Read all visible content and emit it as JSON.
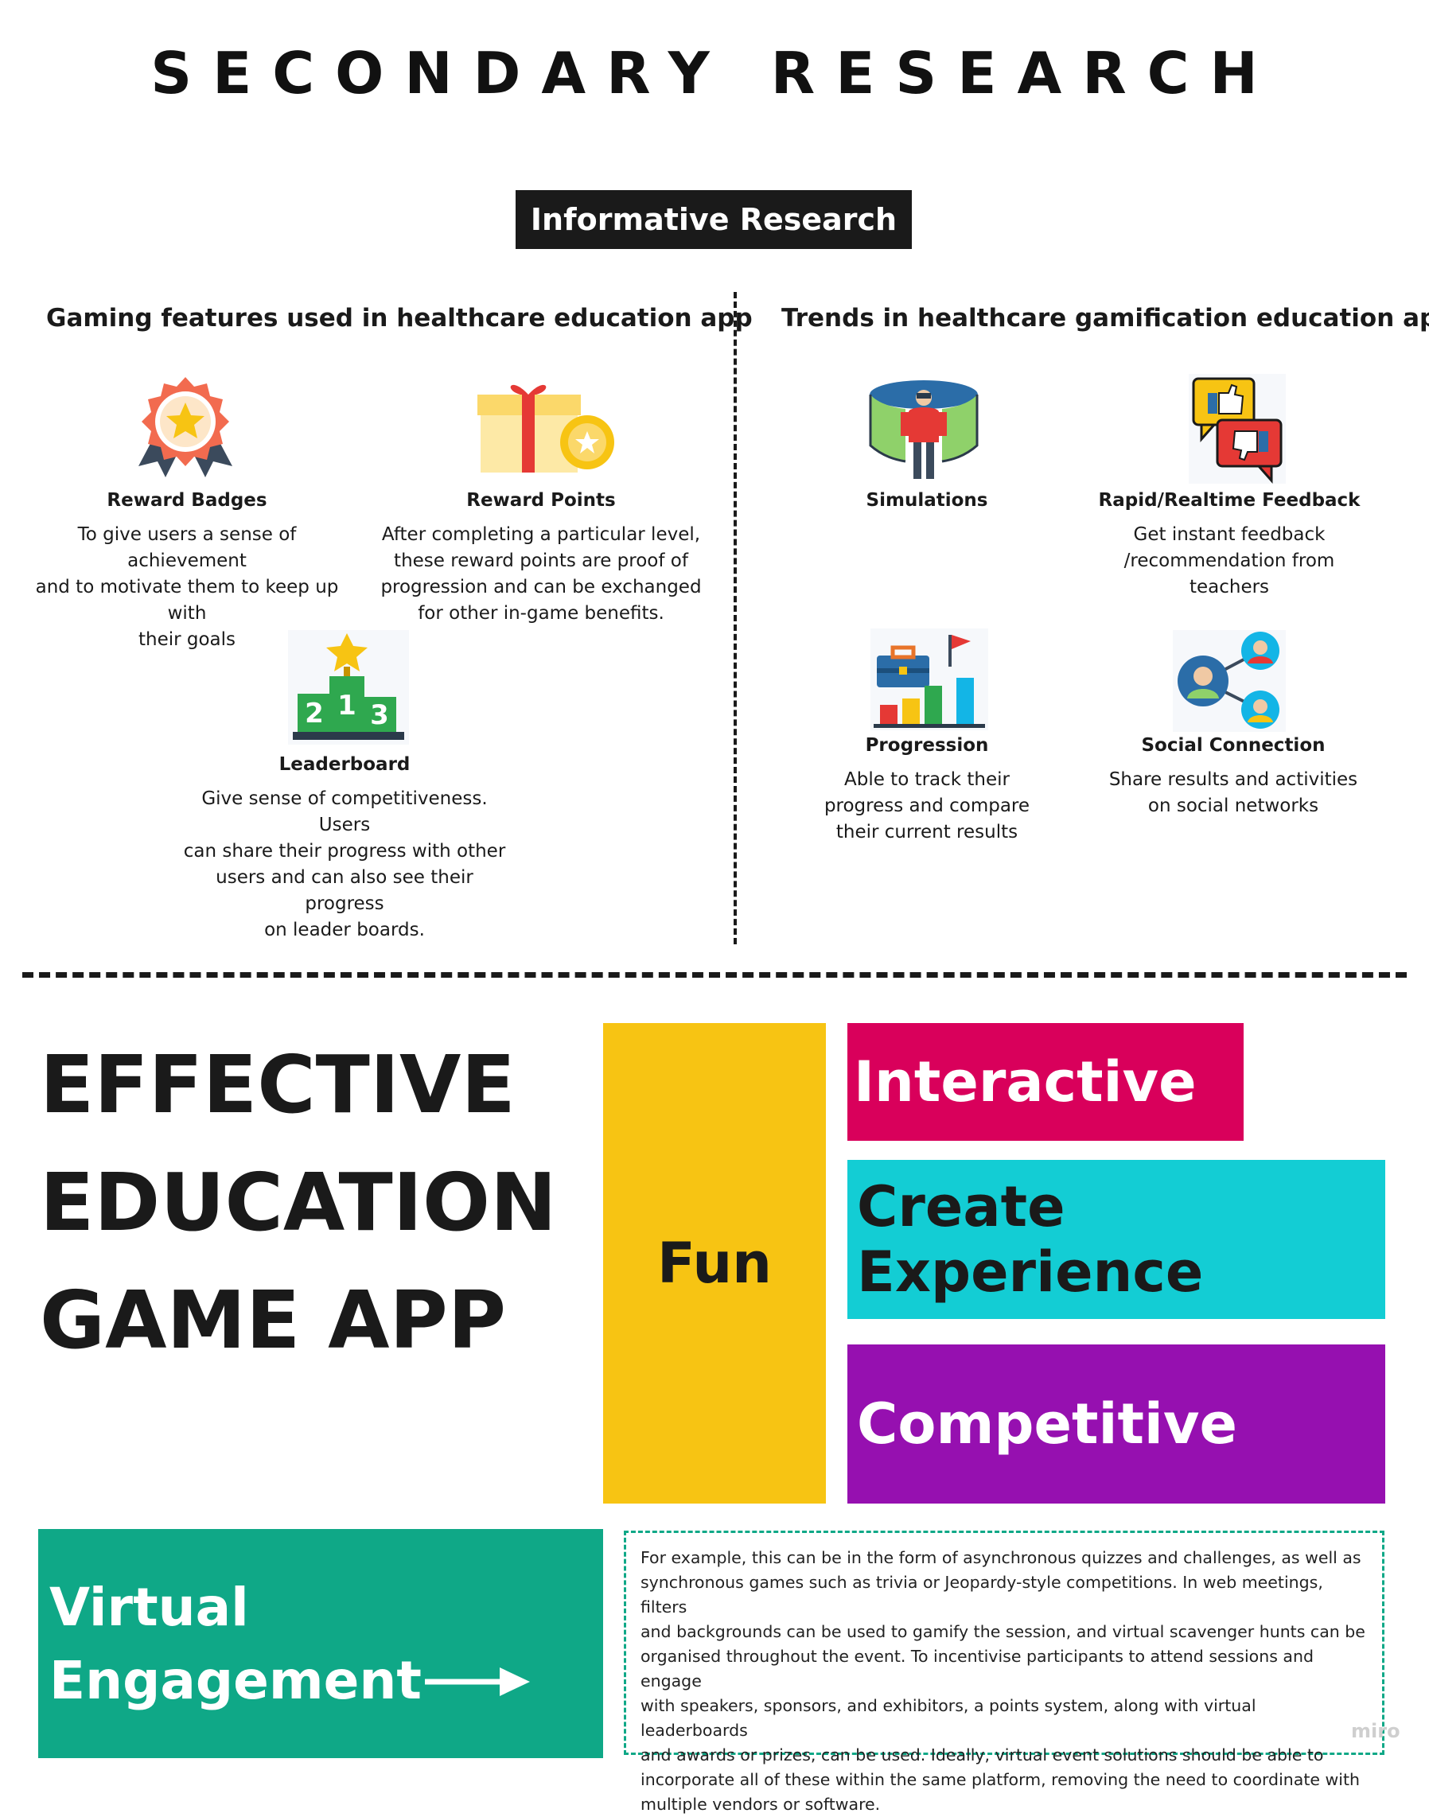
{
  "page_title": "SECONDARY RESEARCH",
  "section_badge": "Informative Research",
  "left_column": {
    "heading": "Gaming features used in healthcare education app",
    "items": [
      {
        "name": "Reward Badges",
        "icon": "badge-icon",
        "desc": [
          "To give users a sense of achievement",
          "and to motivate them to keep up with",
          "their goals"
        ]
      },
      {
        "name": "Reward Points",
        "icon": "gift-icon",
        "desc": [
          "After completing a particular level,",
          "these reward points are proof of",
          "progression and can be exchanged",
          "for other in-game benefits."
        ]
      },
      {
        "name": "Leaderboard",
        "icon": "podium-icon",
        "desc": [
          "Give sense of competitiveness. Users",
          "can share their progress with other",
          "users and can also see their progress",
          "on leader boards."
        ]
      }
    ]
  },
  "right_column": {
    "heading": "Trends in healthcare gamification education app",
    "items": [
      {
        "name": "Simulations",
        "icon": "vr-simulation-icon",
        "desc": []
      },
      {
        "name": "Rapid/Realtime Feedback",
        "icon": "feedback-icon",
        "desc": [
          "Get instant feedback",
          "/recommendation from",
          "teachers"
        ]
      },
      {
        "name": "Progression",
        "icon": "progress-chart-icon",
        "desc": [
          "Able to track their",
          "progress and compare",
          "their current results"
        ]
      },
      {
        "name": "Social Connection",
        "icon": "social-network-icon",
        "desc": [
          "Share results and activities",
          "on social networks"
        ]
      }
    ]
  },
  "effective": {
    "lines": [
      "EFFECTIVE",
      "EDUCATION",
      "GAME APP"
    ]
  },
  "qualities": {
    "fun": "Fun",
    "interactive": "Interactive",
    "create": "Create Experience",
    "competitive": "Competitive"
  },
  "virtual": {
    "line1": "Virtual",
    "line2": "Engagement"
  },
  "example_text": [
    "For example, this can be in the form of asynchronous quizzes and challenges, as well as",
    "synchronous games such as trivia or Jeopardy-style competitions. In web meetings, filters",
    "and backgrounds can be used to gamify the session, and virtual scavenger hunts can be",
    "organised throughout the event. To incentivise participants to attend sessions and engage",
    "with speakers, sponsors, and exhibitors, a points system, along with virtual leaderboards",
    "and awards or prizes, can be used. Ideally, virtual event solutions should be able to",
    "incorporate all of these within the same platform, removing the need to coordinate with",
    "multiple vendors or software."
  ],
  "watermark": "miro",
  "colors": {
    "fun": "#f7c413",
    "interactive": "#d9005b",
    "create": "#13cdd4",
    "competitive": "#9610b0",
    "virtual": "#0fa887"
  }
}
